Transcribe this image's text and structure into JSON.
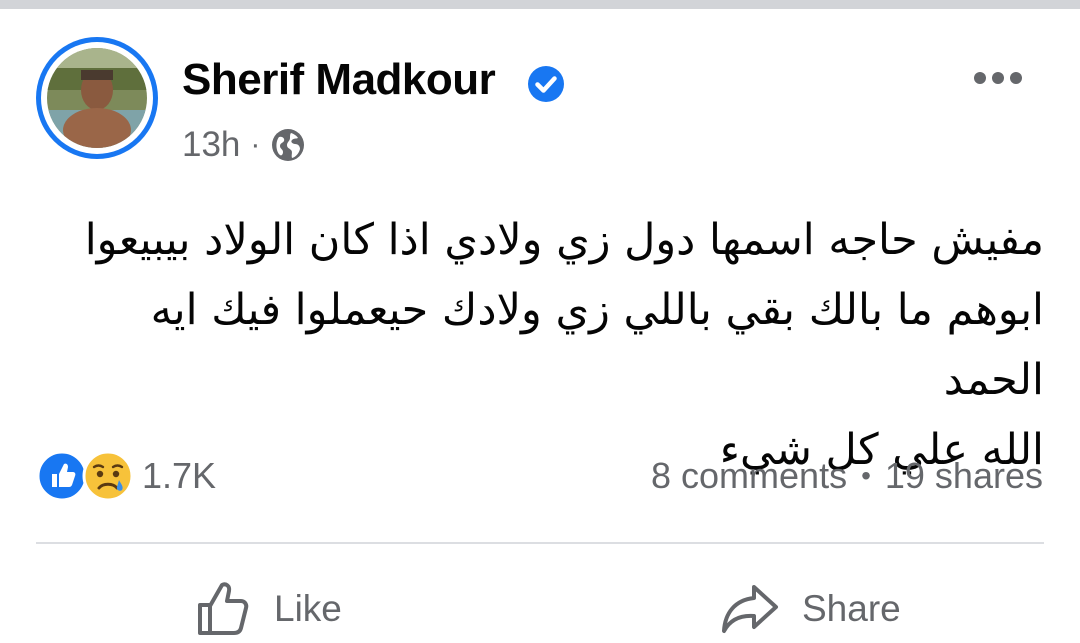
{
  "post": {
    "author": {
      "name": "Sherif Madkour",
      "verified": true,
      "avatar_icon": "profile-photo"
    },
    "timestamp": "13h",
    "separator": "·",
    "privacy_icon": "globe-icon",
    "more_icon": "more-options-icon",
    "body_lines": [
      "مفيش حاجه اسمها دول زي ولادي اذا كان الولاد بيبيعوا",
      "ابوهم ما بالك بقي باللي زي ولادك حيعملوا فيك ايه الحمد",
      "الله علي كل شيء"
    ],
    "reactions": {
      "icons": [
        "like-reaction-icon",
        "sad-reaction-icon"
      ],
      "count": "1.7K"
    },
    "stats": {
      "comments": "8 comments",
      "separator": "•",
      "shares": "19 shares"
    },
    "actions": {
      "like_label": "Like",
      "share_label": "Share"
    },
    "colors": {
      "accent": "#1877f2",
      "text_primary": "#050505",
      "text_secondary": "#65676b",
      "divider": "#dcdee2"
    }
  }
}
